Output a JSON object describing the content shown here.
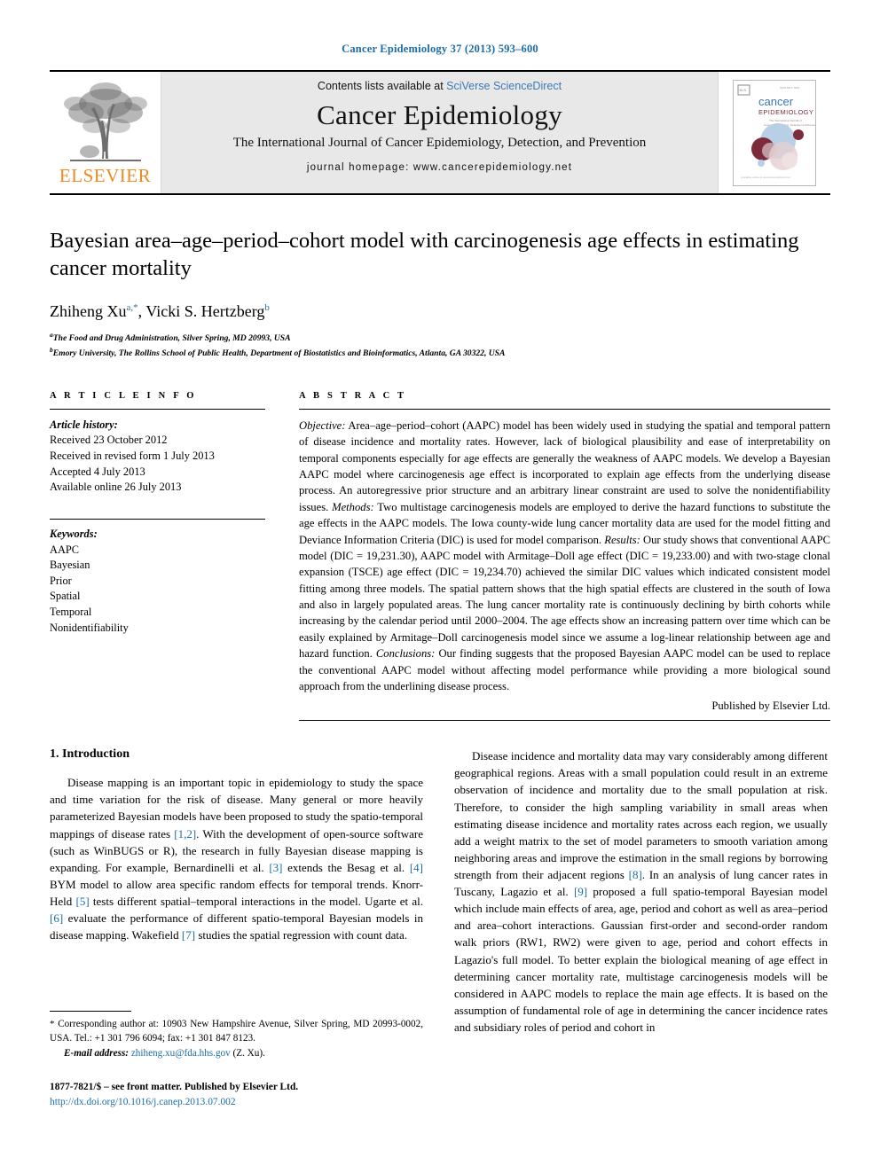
{
  "running_head": "Cancer Epidemiology 37 (2013) 593–600",
  "masthead": {
    "publisher_logo_text": "ELSEVIER",
    "contents_prefix": "Contents lists available at ",
    "contents_link": "SciVerse ScienceDirect",
    "journal_title": "Cancer Epidemiology",
    "journal_subtitle": "The International Journal of Cancer Epidemiology, Detection, and Prevention",
    "homepage": "journal homepage: www.cancerepidemiology.net",
    "cover_title_line1": "cancer",
    "cover_title_line2": "EPIDEMIOLOGY",
    "cover_tagline": "The International Journal of Cancer Epidemiology, Detection and Prevention"
  },
  "article": {
    "title": "Bayesian area–age–period–cohort model with carcinogenesis age effects in estimating cancer mortality",
    "authors_html": "Zhiheng Xu, Vicki S. Hertzberg",
    "author1_name": "Zhiheng Xu",
    "author1_marks": "a,*",
    "author2_name": "Vicki S. Hertzberg",
    "author2_marks": "b",
    "affiliation_a": "The Food and Drug Administration, Silver Spring, MD 20993, USA",
    "affiliation_b": "Emory University, The Rollins School of Public Health, Department of Biostatistics and Bioinformatics, Atlanta, GA 30322, USA"
  },
  "article_info": {
    "heading": "A R T I C L E   I N F O",
    "history_label": "Article history:",
    "history": [
      "Received 23 October 2012",
      "Received in revised form 1 July 2013",
      "Accepted 4 July 2013",
      "Available online 26 July 2013"
    ],
    "keywords_label": "Keywords:",
    "keywords": [
      "AAPC",
      "Bayesian",
      "Prior",
      "Spatial",
      "Temporal",
      "Nonidentifiability"
    ]
  },
  "abstract": {
    "heading": "A B S T R A C T",
    "objective_label": "Objective:",
    "objective_text": " Area–age–period–cohort (AAPC) model has been widely used in studying the spatial and temporal pattern of disease incidence and mortality rates. However, lack of biological plausibility and ease of interpretability on temporal components especially for age effects are generally the weakness of AAPC models. We develop a Bayesian AAPC model where carcinogenesis age effect is incorporated to explain age effects from the underlying disease process. An autoregressive prior structure and an arbitrary linear constraint are used to solve the nonidentifiability issues. ",
    "methods_label": "Methods:",
    "methods_text": " Two multistage carcinogenesis models are employed to derive the hazard functions to substitute the age effects in the AAPC models. The Iowa county-wide lung cancer mortality data are used for the model fitting and Deviance Information Criteria (DIC) is used for model comparison. ",
    "results_label": "Results:",
    "results_text": " Our study shows that conventional AAPC model (DIC = 19,231.30), AAPC model with Armitage–Doll age effect (DIC = 19,233.00) and with two-stage clonal expansion (TSCE) age effect (DIC = 19,234.70) achieved the similar DIC values which indicated consistent model fitting among three models. The spatial pattern shows that the high spatial effects are clustered in the south of Iowa and also in largely populated areas. The lung cancer mortality rate is continuously declining by birth cohorts while increasing by the calendar period until 2000–2004. The age effects show an increasing pattern over time which can be easily explained by Armitage–Doll carcinogenesis model since we assume a log-linear relationship between age and hazard function. ",
    "conclusions_label": "Conclusions:",
    "conclusions_text": " Our finding suggests that the proposed Bayesian AAPC model can be used to replace the conventional AAPC model without affecting model performance while providing a more biological sound approach from the underlining disease process.",
    "published_by": "Published by Elsevier Ltd."
  },
  "introduction": {
    "heading": "1. Introduction",
    "left_para_1a": "Disease mapping is an important topic in epidemiology to study the space and time variation for the risk of disease. Many general or more heavily parameterized Bayesian models have been proposed to study the spatio-temporal mappings of disease rates ",
    "cite_1_2": "[1,2]",
    "left_para_1b": ". With the development of open-source software (such as WinBUGS or R), the research in fully Bayesian disease mapping is expanding. For example, Bernardinelli et al. ",
    "cite_3": "[3]",
    "left_para_1c": " extends the Besag et al. ",
    "cite_4": "[4]",
    "left_para_1d": " BYM model to allow area specific random effects for temporal trends. Knorr-Held ",
    "cite_5": "[5]",
    "left_para_1e": " tests different spatial–temporal interactions in the model. Ugarte et al. ",
    "cite_6": "[6]",
    "left_para_1f": " evaluate the performance of different spatio-temporal Bayesian models in disease mapping. Wakefield ",
    "cite_7": "[7]",
    "left_para_1g": " studies the spatial regression with count data.",
    "right_para_1a": "Disease incidence and mortality data may vary considerably among different geographical regions. Areas with a small population could result in an extreme observation of incidence and mortality due to the small population at risk. Therefore, to consider the high sampling variability in small areas when estimating disease incidence and mortality rates across each region, we usually add a weight matrix to the set of model parameters to smooth variation among neighboring areas and improve the estimation in the small regions by borrowing strength from their adjacent regions ",
    "cite_8": "[8]",
    "right_para_1b": ". In an analysis of lung cancer rates in Tuscany, Lagazio et al. ",
    "cite_9": "[9]",
    "right_para_1c": " proposed a full spatio-temporal Bayesian model which include main effects of area, age, period and cohort as well as area–period and area–cohort interactions. Gaussian first-order and second-order random walk priors (RW1, RW2) were given to age, period and cohort effects in Lagazio's full model. To better explain the biological meaning of age effect in determining cancer mortality rate, multistage carcinogenesis models will be considered in AAPC models to replace the main age effects. It is based on the assumption of fundamental role of age in determining the cancer incidence rates and subsidiary roles of period and cohort in"
  },
  "footnotes": {
    "corresponding_star": "*",
    "corresponding_text": " Corresponding author at: 10903 New Hampshire Avenue, Silver Spring, MD 20993-0002, USA. Tel.: +1 301 796 6094; fax: +1 301 847 8123.",
    "email_label": "E-mail address:",
    "email_value": "zhiheng.xu@fda.hhs.gov",
    "email_suffix": " (Z. Xu)."
  },
  "colophon": {
    "issn_line": "1877-7821/$ – see front matter. Published by Elsevier Ltd.",
    "doi": "http://dx.doi.org/10.1016/j.canep.2013.07.002"
  },
  "colors": {
    "link_blue": "#1b6ca8",
    "elsevier_orange": "#f08a1d",
    "band_gray": "#e8e8e8"
  }
}
